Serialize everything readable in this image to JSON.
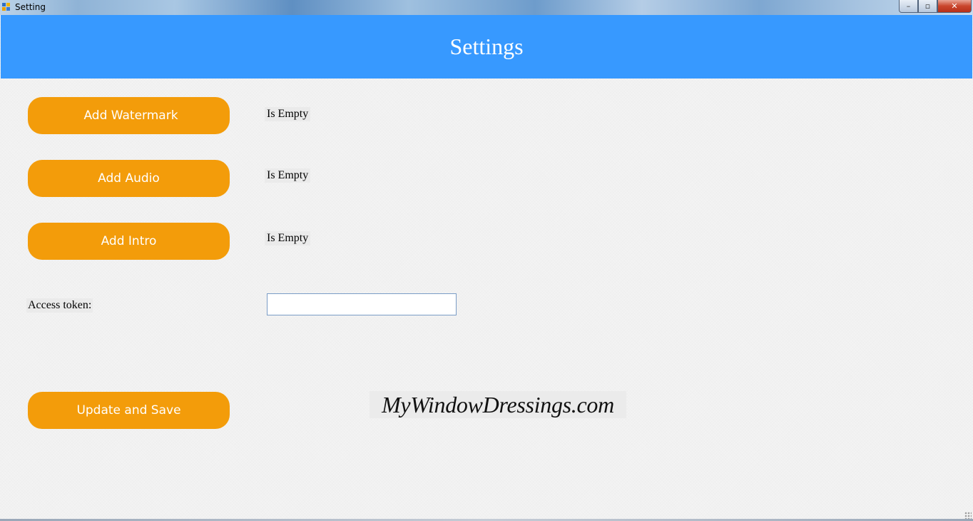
{
  "window": {
    "title": "Setting",
    "controls": {
      "minimize": "–",
      "maximize": "▫",
      "close": "✕"
    }
  },
  "header": {
    "title": "Settings",
    "background_color": "#3799ff"
  },
  "actions": {
    "watermark_label": "Add Watermark",
    "audio_label": "Add Audio",
    "intro_label": "Add Intro",
    "save_label": "Update and Save",
    "button_color": "#f39c0a"
  },
  "status": {
    "watermark": "Is Empty",
    "audio": "Is Empty",
    "intro": "Is Empty"
  },
  "token": {
    "label": "Access token:",
    "value": "",
    "placeholder": ""
  },
  "branding": {
    "text": "MyWindowDressings.com"
  }
}
